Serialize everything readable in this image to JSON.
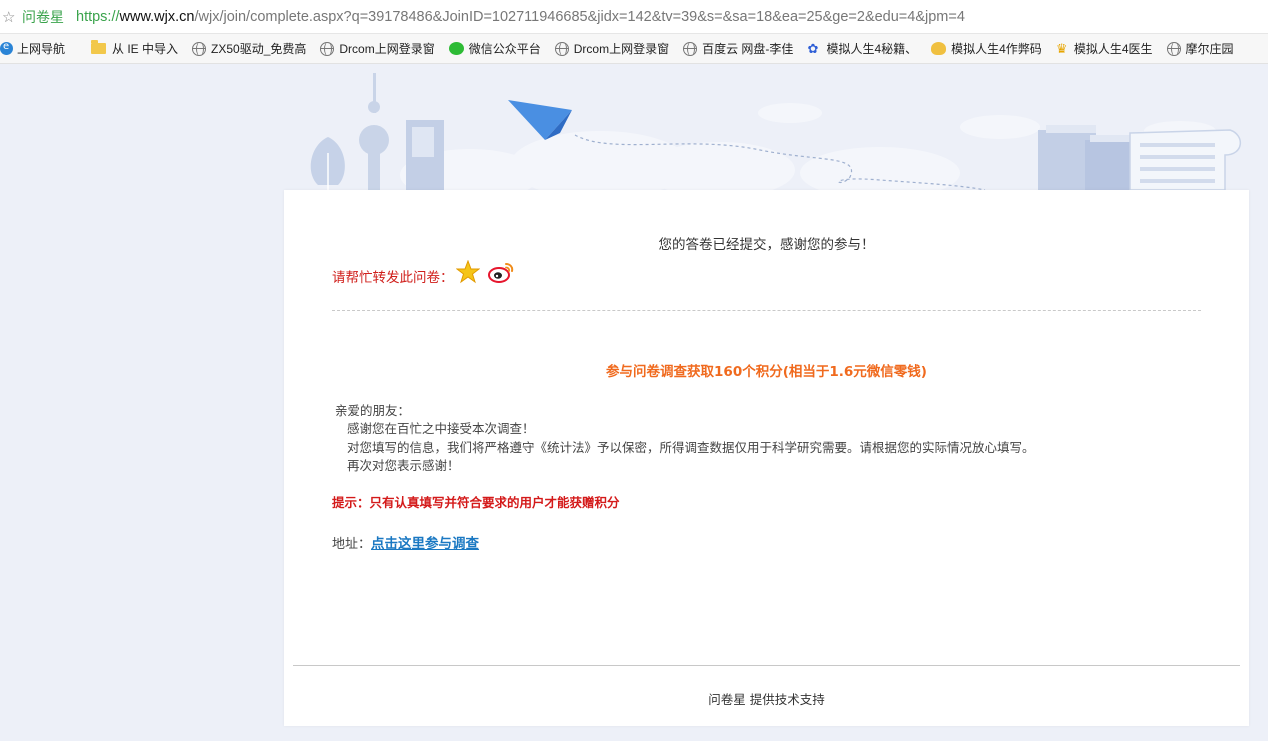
{
  "browser": {
    "site_name": "问卷星",
    "url_scheme": "https://",
    "url_domain": "www.wjx.cn",
    "url_path": "/wjx/join/complete.aspx?q=39178486&JoinID=102711946685&jidx=142&tv=39&s=&sa=18&ea=25&ge=2&edu=4&jpm=4"
  },
  "bookmarks": [
    {
      "label": "上网导航",
      "icon": "nav-icon"
    },
    {
      "label": "从 IE 中导入",
      "icon": "folder-icon"
    },
    {
      "label": "ZX50驱动_免费高",
      "icon": "globe-icon"
    },
    {
      "label": "Drcom上网登录窗",
      "icon": "globe-icon"
    },
    {
      "label": "微信公众平台",
      "icon": "wechat-icon"
    },
    {
      "label": "Drcom上网登录窗",
      "icon": "globe-icon"
    },
    {
      "label": "百度云 网盘-李佳",
      "icon": "globe-icon"
    },
    {
      "label": "模拟人生4秘籍、",
      "icon": "baidu-icon"
    },
    {
      "label": "模拟人生4作弊码",
      "icon": "kid-icon"
    },
    {
      "label": "模拟人生4医生",
      "icon": "trophy-icon"
    },
    {
      "label": "摩尔庄园",
      "icon": "globe-icon"
    }
  ],
  "page": {
    "thanks": "您的答卷已经提交，感谢您的参与！",
    "share_label": "请帮忙转发此问卷：",
    "points_heading": "参与问卷调查获取160个积分(相当于1.6元微信零钱)",
    "letter": {
      "greeting": "亲爱的朋友：",
      "line1": "感谢您在百忙之中接受本次调查！",
      "line2": "对您填写的信息，我们将严格遵守《统计法》予以保密，所得调查数据仅用于科学研究需要。请根据您的实际情况放心填写。",
      "line3": "再次对您表示感谢！"
    },
    "tip": "提示：只有认真填写并符合要求的用户才能获赠积分",
    "address_label": "地址：",
    "address_link": "点击这里参与调查",
    "footer": "问卷星 提供技术支持"
  },
  "colors": {
    "background": "#edf0f8",
    "share_label": "#d0201c",
    "points_heading": "#f06a1e",
    "tip": "#d41a1a",
    "link": "#1a78c2",
    "url_green": "#3aa34c"
  }
}
